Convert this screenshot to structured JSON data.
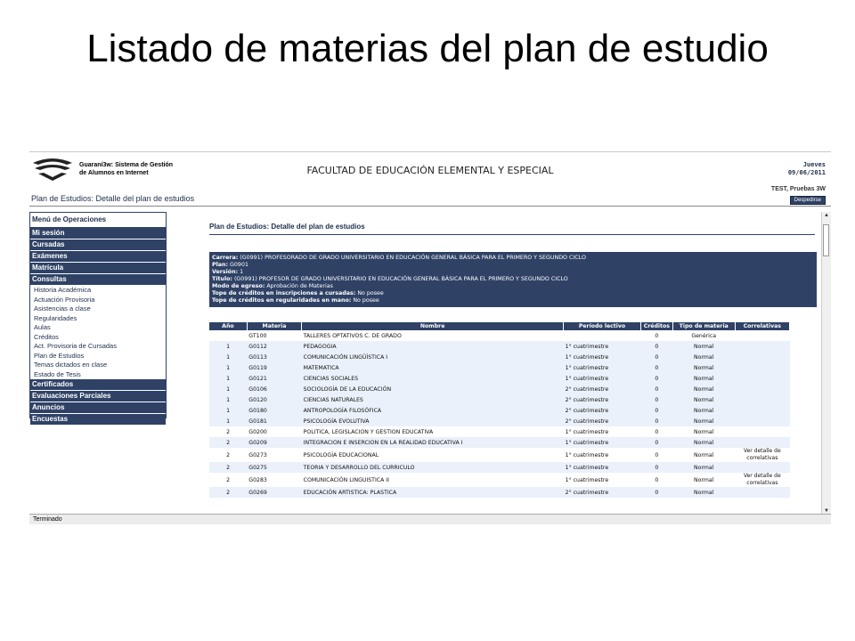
{
  "slide_title": "Listado de materias del plan de estudio",
  "header": {
    "system_name_1": "Guaraní3w: Sistema de Gestión",
    "system_name_2": "de Alumnos en Internet",
    "faculty": "FACULTAD DE EDUCACIÓN ELEMENTAL Y ESPECIAL",
    "day": "Jueves",
    "date": "09/06/2011",
    "user": "TEST, Pruebas 3W",
    "logout": "Despedirse"
  },
  "breadcrumb": "Plan de Estudios: Detalle del plan de estudios",
  "sidebar": {
    "heading": "Menú de Operaciones",
    "top_items": [
      "Mi sesión",
      "Cursadas",
      "Exámenes",
      "Matrícula",
      "Consultas"
    ],
    "sub_items": [
      "Historia Académica",
      "Actuación Provisoria",
      "Asistencias a clase",
      "Regularidades",
      "Aulas",
      "Créditos",
      "Act. Provisoria de Cursadas",
      "Plan de Estudios",
      "Temas dictados en clase",
      "Estado de Tesis"
    ],
    "bottom_items": [
      "Certificados",
      "Evaluaciones Parciales",
      "Anuncios",
      "Encuestas"
    ]
  },
  "page_title": "Plan de Estudios: Detalle del plan de estudios",
  "info": {
    "carrera_label": "Carrera:",
    "carrera": "(G0991) PROFESORADO DE GRADO UNIVERSITARIO EN EDUCACIÓN GENERAL BÁSICA PARA EL PRIMERO Y SEGUNDO CICLO",
    "plan_label": "Plan:",
    "plan": "G0901",
    "version_label": "Versión:",
    "version": "1",
    "titulo_label": "Título:",
    "titulo": "(G0991) PROFESOR DE GRADO UNIVERSITARIO EN EDUCACIÓN GENERAL BÁSICA PARA EL PRIMERO Y SEGUNDO CICLO",
    "modo_label": "Modo de egreso:",
    "modo": "Aprobación de Materias",
    "tope1_label": "Tope de créditos en inscripciones a cursadas:",
    "tope1": "No posee",
    "tope2_label": "Tope de créditos en regularidades en mano:",
    "tope2": "No posee"
  },
  "table": {
    "headers": [
      "Año",
      "Materia",
      "Nombre",
      "Período lectivo",
      "Créditos",
      "Tipo de materia",
      "Correlativas"
    ],
    "rows": [
      [
        "",
        "GT100",
        "TALLERES OPTATIVOS C. DE GRADO",
        "",
        "0",
        "Genérica",
        ""
      ],
      [
        "1",
        "G0112",
        "PEDAGOGIA",
        "1° cuatrimestre",
        "0",
        "Normal",
        ""
      ],
      [
        "1",
        "G0113",
        "COMUNICACIÓN LINGÜÍSTICA I",
        "1° cuatrimestre",
        "0",
        "Normal",
        ""
      ],
      [
        "1",
        "G0119",
        "MATEMATICA",
        "1° cuatrimestre",
        "0",
        "Normal",
        ""
      ],
      [
        "1",
        "G0121",
        "CIENCIAS SOCIALES",
        "1° cuatrimestre",
        "0",
        "Normal",
        ""
      ],
      [
        "1",
        "G0106",
        "SOCIOLOGÍA DE LA EDUCACIÓN",
        "2° cuatrimestre",
        "0",
        "Normal",
        ""
      ],
      [
        "1",
        "G0120",
        "CIENCIAS NATURALES",
        "2° cuatrimestre",
        "0",
        "Normal",
        ""
      ],
      [
        "1",
        "G0180",
        "ANTROPOLOGÍA FILOSÓFICA",
        "2° cuatrimestre",
        "0",
        "Normal",
        ""
      ],
      [
        "1",
        "G0181",
        "PSICOLOGÍA EVOLUTIVA",
        "2° cuatrimestre",
        "0",
        "Normal",
        ""
      ],
      [
        "2",
        "G0200",
        "POLITICA, LEGISLACION Y GESTION EDUCATIVA",
        "1° cuatrimestre",
        "0",
        "Normal",
        ""
      ],
      [
        "2",
        "G0209",
        "INTEGRACION E INSERCION EN LA REALIDAD EDUCATIVA I",
        "1° cuatrimestre",
        "0",
        "Normal",
        ""
      ],
      [
        "2",
        "G0273",
        "PSICOLOGÍA EDUCACIONAL",
        "1° cuatrimestre",
        "0",
        "Normal",
        "Ver detalle de correlativas"
      ],
      [
        "2",
        "G0275",
        "TEORIA Y DESARROLLO DEL CURRICULO",
        "1° cuatrimestre",
        "0",
        "Normal",
        ""
      ],
      [
        "2",
        "G0283",
        "COMUNICACIÓN LINGUISTICA II",
        "1° cuatrimestre",
        "0",
        "Normal",
        "Ver detalle de correlativas"
      ],
      [
        "2",
        "G0269",
        "EDUCACIÓN ARTISTICA: PLASTICA",
        "2° cuatrimestre",
        "0",
        "Normal",
        ""
      ]
    ]
  },
  "status_bar": "Terminado"
}
